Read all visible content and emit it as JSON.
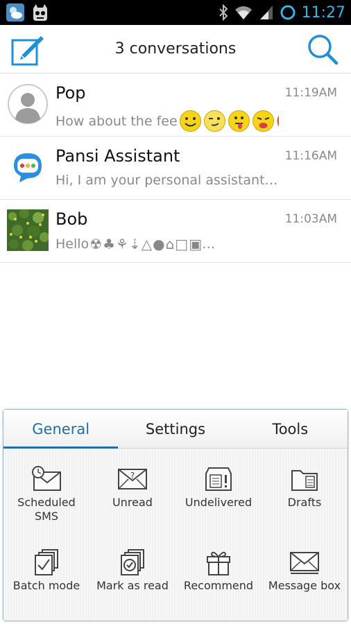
{
  "status_bar": {
    "time": "11:27",
    "colors": {
      "time": "#33b5e5"
    }
  },
  "header": {
    "title": "3 conversations",
    "compose_icon": "compose-icon",
    "search_icon": "search-icon",
    "accent": "#1e90d6"
  },
  "conversations": [
    {
      "name": "Pop",
      "time": "11:19AM",
      "snippet": "How about the fee",
      "avatar": "default-contact-avatar"
    },
    {
      "name": "Pansi Assistant",
      "time": "11:16AM",
      "snippet": "Hi, I am your personal assistant…",
      "avatar": "pansi-assistant-logo"
    },
    {
      "name": "Bob",
      "time": "11:03AM",
      "snippet": "Hello",
      "snippet_suffix": "…",
      "avatar": "bob-photo"
    }
  ],
  "menu": {
    "tabs": [
      {
        "label": "General",
        "active": true
      },
      {
        "label": "Settings",
        "active": false
      },
      {
        "label": "Tools",
        "active": false
      }
    ],
    "items": [
      {
        "label": "Scheduled\nSMS",
        "icon": "scheduled-sms-icon"
      },
      {
        "label": "Unread",
        "icon": "unread-icon"
      },
      {
        "label": "Undelivered",
        "icon": "undelivered-icon"
      },
      {
        "label": "Drafts",
        "icon": "drafts-icon"
      },
      {
        "label": "Batch mode",
        "icon": "batch-mode-icon"
      },
      {
        "label": "Mark as read",
        "icon": "mark-as-read-icon"
      },
      {
        "label": "Recommend",
        "icon": "recommend-icon"
      },
      {
        "label": "Message box",
        "icon": "message-box-icon"
      }
    ],
    "accent": "#1e6ea7"
  }
}
